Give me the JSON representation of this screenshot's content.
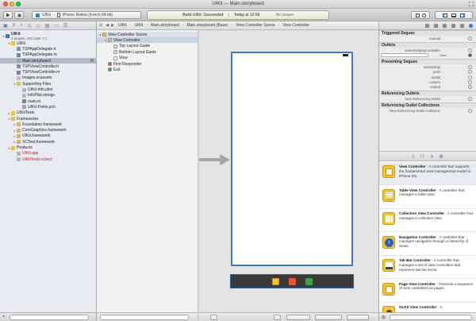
{
  "window": {
    "title": "UIKit — Main.storyboard",
    "traffic_colors": [
      "#ff5f57",
      "#febc2e",
      "#28c840"
    ]
  },
  "toolbar": {
    "scheme": "UIKit",
    "destination": "iPhone Retina (4-inch 64-bit)",
    "activity_status": "Build UIKit: Succeeded",
    "activity_time": "Today at 12:56",
    "issues": "No Issues"
  },
  "navigator": {
    "items": [
      {
        "label": "UIKit",
        "sub": "2 targets, iOS SDK 7.1",
        "depth": 0,
        "disclosure": "▾",
        "icon": "fi-proj",
        "bold": true
      },
      {
        "label": "UIKit",
        "depth": 1,
        "disclosure": "▾",
        "icon": "fi-folder"
      },
      {
        "label": "TSPAppDelegate.h",
        "depth": 2,
        "icon": "fi-h"
      },
      {
        "label": "TSPAppDelegate.m",
        "depth": 2,
        "icon": "fi-m"
      },
      {
        "label": "Main.storyboard",
        "depth": 2,
        "icon": "fi-sb",
        "selected": true,
        "badge": "M"
      },
      {
        "label": "TSPViewController.h",
        "depth": 2,
        "icon": "fi-h"
      },
      {
        "label": "TSPViewController.m",
        "depth": 2,
        "icon": "fi-m"
      },
      {
        "label": "Images.xcassets",
        "depth": 2,
        "icon": "fi-xc"
      },
      {
        "label": "Supporting Files",
        "depth": 2,
        "disclosure": "▾",
        "icon": "fi-folder"
      },
      {
        "label": "UIKit-Info.plist",
        "depth": 3,
        "icon": "fi-plist"
      },
      {
        "label": "InfoPlist.strings",
        "depth": 3,
        "icon": "fi-plist"
      },
      {
        "label": "main.m",
        "depth": 3,
        "icon": "fi-m"
      },
      {
        "label": "UIKit-Prefix.pch",
        "depth": 3,
        "icon": "fi-pch"
      },
      {
        "label": "UIKitTests",
        "depth": 1,
        "disclosure": "▸",
        "icon": "fi-folder"
      },
      {
        "label": "Frameworks",
        "depth": 1,
        "disclosure": "▾",
        "icon": "fi-folder"
      },
      {
        "label": "Foundation.framework",
        "depth": 2,
        "disclosure": "▸",
        "icon": "fi-fw"
      },
      {
        "label": "CoreGraphics.framework",
        "depth": 2,
        "disclosure": "▸",
        "icon": "fi-fw"
      },
      {
        "label": "UIKit.framework",
        "depth": 2,
        "disclosure": "▸",
        "icon": "fi-fw"
      },
      {
        "label": "XCTest.framework",
        "depth": 2,
        "disclosure": "▸",
        "icon": "fi-fw"
      },
      {
        "label": "Products",
        "depth": 1,
        "disclosure": "▾",
        "icon": "fi-prod"
      },
      {
        "label": "UIKit.app",
        "depth": 2,
        "icon": "fi-plist",
        "red": true
      },
      {
        "label": "UIKitTests.xctest",
        "depth": 2,
        "icon": "fi-plist",
        "red": true
      }
    ]
  },
  "jumpbar": {
    "crumbs": [
      "UIKit",
      "UIKit",
      "Main.storyboard",
      "Main.storyboard (Base)",
      "View Controller Scene",
      "View Controller"
    ]
  },
  "outline": {
    "items": [
      {
        "label": "View Controller Scene",
        "depth": 0,
        "disclosure": "▾",
        "head": true,
        "icon_color": "#e8c43b"
      },
      {
        "label": "View Controller",
        "depth": 1,
        "disclosure": "▾",
        "selected": true,
        "icon_color": "#f3c436"
      },
      {
        "label": "Top Layout Guide",
        "depth": 2,
        "icon_color": "#d6d6d6"
      },
      {
        "label": "Bottom Layout Guide",
        "depth": 2,
        "icon_color": "#d6d6d6"
      },
      {
        "label": "View",
        "depth": 2,
        "icon_color": "#ffffff"
      },
      {
        "label": "First Responder",
        "depth": 1,
        "icon_color": "#e6553a"
      },
      {
        "label": "Exit",
        "depth": 1,
        "icon_color": "#3aa34a"
      }
    ]
  },
  "inspector": {
    "sections": [
      {
        "title": "Triggered Segues",
        "rows": [
          "manual"
        ]
      },
      {
        "title": "Outlets",
        "rows": [
          "searchDisplayController",
          "view"
        ],
        "view_field": "View"
      },
      {
        "title": "Presenting Segues",
        "rows": [
          "relationship",
          "push",
          "modal",
          "custom",
          "embed"
        ]
      },
      {
        "title": "Referencing Outlets",
        "rows": [
          "New Referencing Outlet"
        ]
      },
      {
        "title": "Referencing Outlet Collections",
        "rows": [
          "New Referencing Outlet Collection"
        ]
      }
    ]
  },
  "library": {
    "items": [
      {
        "name": "View Controller",
        "desc": " - A controller that supports the fundamental view-management model in iPhone OS.",
        "selected": true,
        "glyph": "view-controller-icon"
      },
      {
        "name": "Table View Controller",
        "desc": " - A controller that manages a table view.",
        "glyph": "table-view-controller-icon"
      },
      {
        "name": "Collection View Controller",
        "desc": " - A controller that manages a collection view.",
        "glyph": "collection-view-controller-icon"
      },
      {
        "name": "Navigation Controller",
        "desc": " - A controller that manages navigation through a hierarchy of views.",
        "glyph": "navigation-controller-icon"
      },
      {
        "name": "Tab Bar Controller",
        "desc": " - A controller that manages a set of view controllers that represent tab bar items.",
        "glyph": "tab-bar-controller-icon"
      },
      {
        "name": "Page View Controller",
        "desc": " - Presents a sequence of view controllers as pages.",
        "glyph": "page-view-controller-icon"
      },
      {
        "name": "GLKit View Controller",
        "desc": " - A",
        "glyph": "glkit-view-controller-icon"
      }
    ]
  },
  "colors": {
    "selection": "#b4bcc8",
    "accent": "#2f7bd3",
    "canvas_border": "#3e7bc8",
    "library_icon": "#f3c436"
  }
}
